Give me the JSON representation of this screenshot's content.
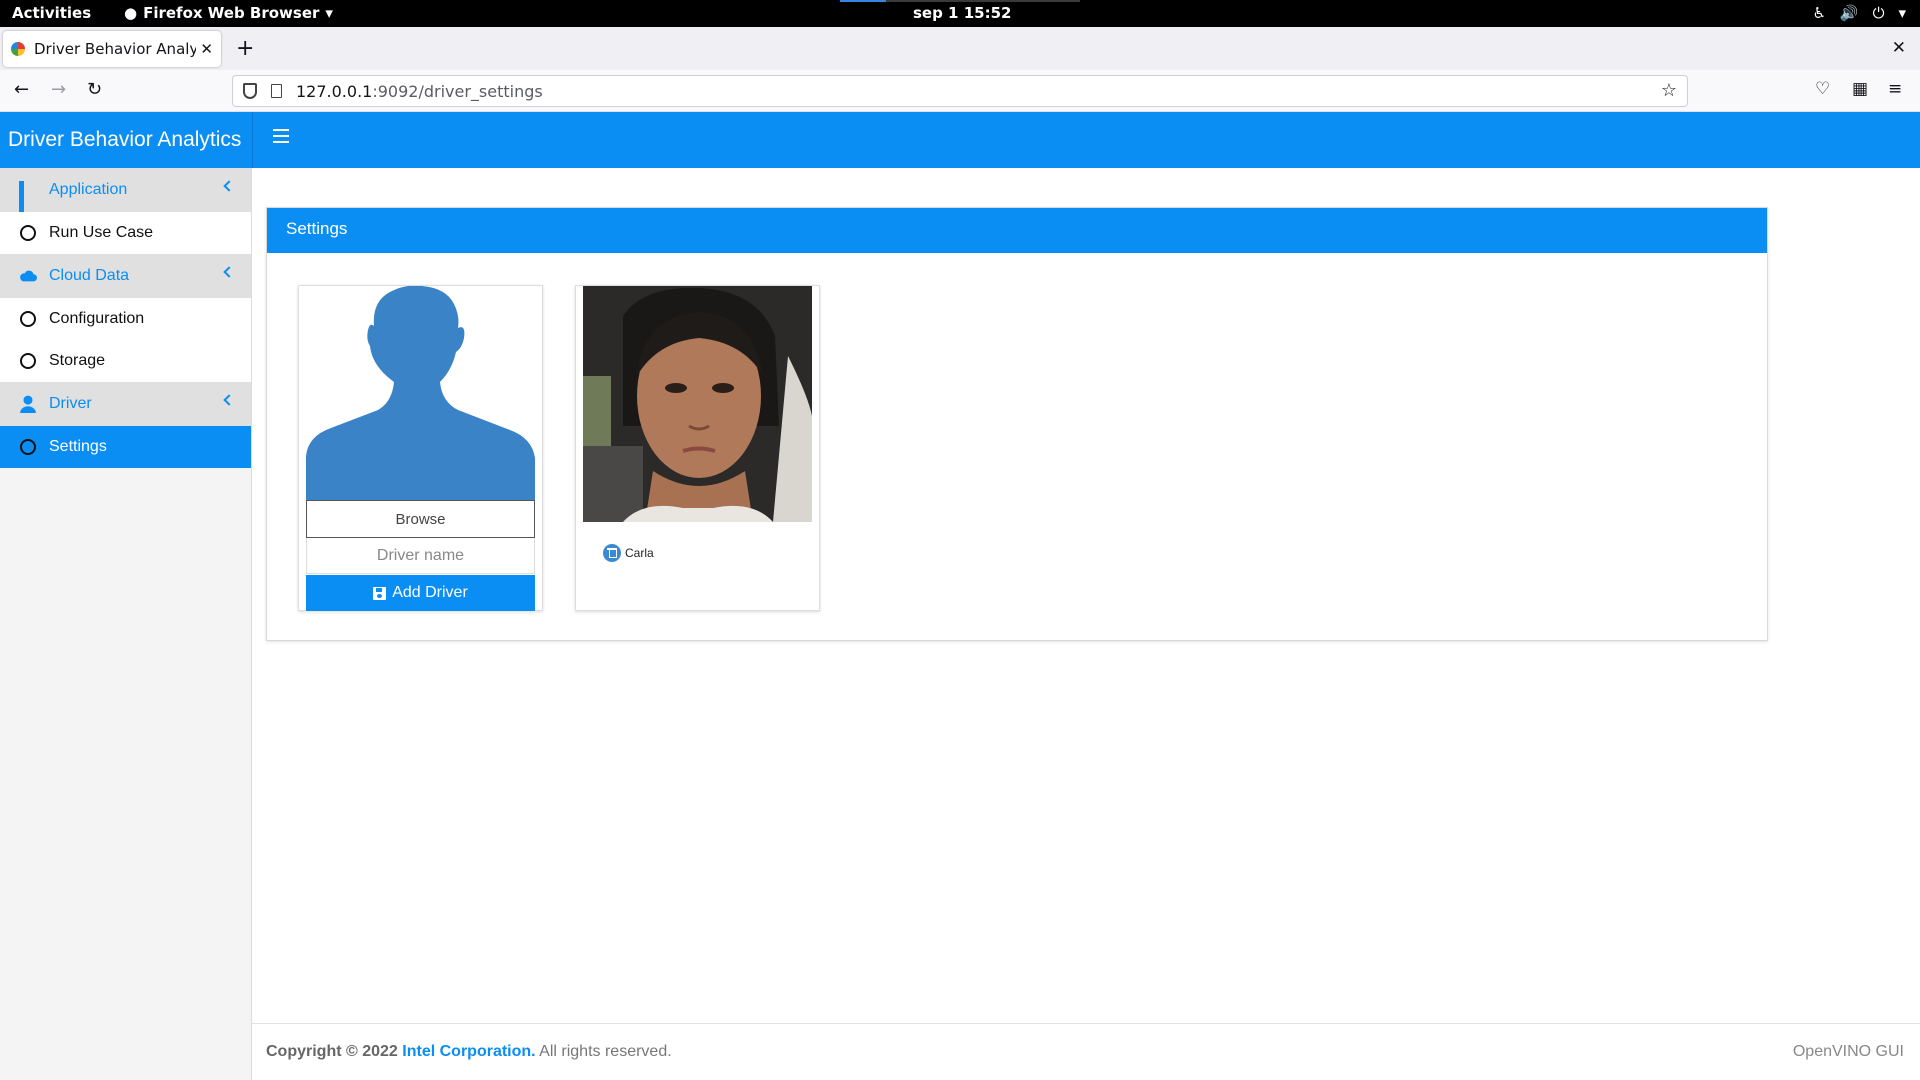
{
  "os": {
    "activities": "Activities",
    "app_menu": "Firefox Web Browser",
    "clock": "sep 1 15:52"
  },
  "browser": {
    "tab_title": "Driver Behavior Analytics",
    "url_host": "127.0.0.1",
    "url_path": ":9092/driver_settings"
  },
  "app": {
    "brand": "Driver Behavior Analytics",
    "accent_color": "#0a8ef4"
  },
  "sidebar": {
    "groups": [
      {
        "label": "Application",
        "icon": "grid-icon",
        "items": [
          {
            "label": "Run Use Case"
          }
        ]
      },
      {
        "label": "Cloud Data",
        "icon": "cloud-icon",
        "items": [
          {
            "label": "Configuration"
          },
          {
            "label": "Storage"
          }
        ]
      },
      {
        "label": "Driver",
        "icon": "user-icon",
        "items": [
          {
            "label": "Settings",
            "active": true
          }
        ]
      }
    ]
  },
  "settings": {
    "title": "Settings",
    "new_driver": {
      "browse_label": "Browse",
      "name_placeholder": "Driver name",
      "add_label": "Add Driver"
    },
    "drivers": [
      {
        "name": "Carla"
      }
    ]
  },
  "footer": {
    "copyright_prefix": "Copyright © 2022",
    "company": "Intel Corporation.",
    "rights": "All rights reserved.",
    "product": "OpenVINO GUI"
  }
}
